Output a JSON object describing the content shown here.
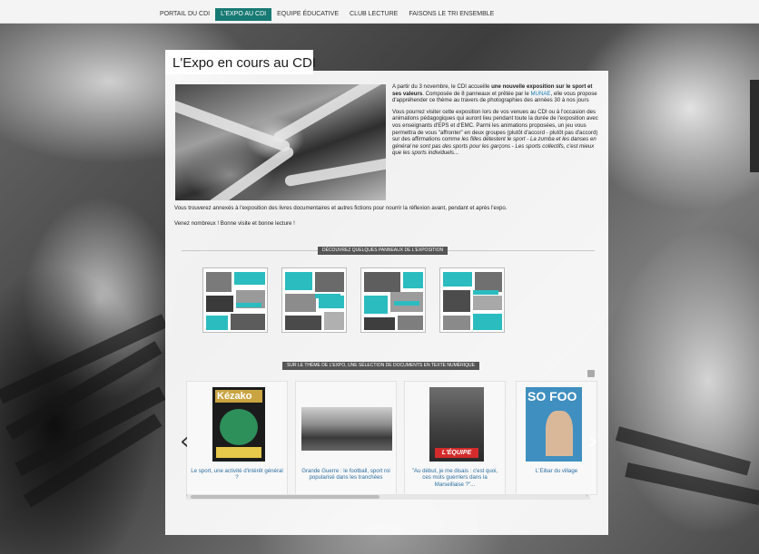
{
  "nav": {
    "items": [
      {
        "label": "PORTAIL DU CDI",
        "active": false
      },
      {
        "label": "L'EXPO AU CDI",
        "active": true
      },
      {
        "label": "EQUIPE ÉDUCATIVE",
        "active": false
      },
      {
        "label": "CLUB LECTURE",
        "active": false
      },
      {
        "label": "FAISONS LE TRI ENSEMBLE",
        "active": false
      }
    ],
    "accent_color": "#187a74"
  },
  "page": {
    "title": "L'Expo en cours au CDI"
  },
  "intro": {
    "p1_a": "A partir du 3 novembre, le CDI accueille ",
    "p1_b": "une nouvelle exposition sur le sport et ses valeurs",
    "p1_c": ". Composée de 8 panneaux et prêtée par le ",
    "p1_link": "MUNAE",
    "p1_d": ", elle vous propose d'appréhender ce thème au travers de photographies des années 30 à nos jours",
    "p2_a": "Vous pourrez visiter cette exposition lors de vos venues au CDI ou à l'occasion des animations pédagogiques qui auront lieu pendant toute la durée de l'exposition avec vos enseignants d'EPS et d'EMC. Parmi les animations proposées, un jeu vous permettra de vous \"affronter\" en deux groupes (plutôt d'accord - plutôt pas d'accord) sur des affirmations comme ",
    "p2_b": "les filles détestent le sport - La zumba et les danses en général ne sont pas des sports pour les garçons - Les sports collectifs, c'est mieux que les sports individuels...",
    "line1": "Vous trouverez annexés à l'exposition des livres documentaires et autres fictions pour nourrir la réflexion avant, pendant et après l'expo.",
    "line2": "Venez nombreux ! Bonne visite et bonne lecture !"
  },
  "posters_section": {
    "label": "DÉCOUVREZ QUELQUES PANNEAUX DE L'EXPOSITION",
    "posters": [
      "poster-1",
      "poster-2",
      "poster-3",
      "poster-4"
    ]
  },
  "docs_section": {
    "label": "SUR LE THÈME DE L'EXPO, UNE SÉLECTION DE DOCUMENTS EN TEXTE NUMÉRIQUE",
    "cards": [
      {
        "caption": "Le sport, une activité d'intérêt général ?",
        "thumb_title": "Kézako"
      },
      {
        "caption": "Grande Guerre : le football, sport roi popularisé dans les tranchées"
      },
      {
        "caption": "\"Au début, je me disais : c'est quoi, ces mots guerriers dans la Marseillaise ?\"...",
        "thumb_title": "L'ÉQUIPE"
      },
      {
        "caption": "L'Eibar du village",
        "thumb_title": "SO FOO"
      }
    ]
  },
  "icons": {
    "prev": "‹",
    "next": "›",
    "scroll_left": "‹",
    "scroll_right": "›"
  }
}
